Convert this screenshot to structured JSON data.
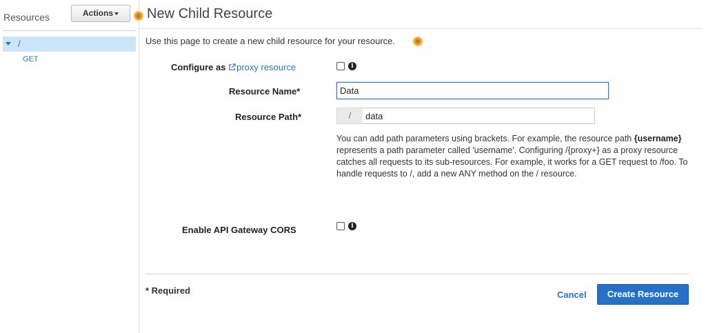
{
  "sidebar": {
    "title": "Resources",
    "actions_label": "Actions",
    "tree": {
      "root_label": "/",
      "methods": [
        "GET"
      ]
    }
  },
  "main": {
    "title": "New Child Resource",
    "intro": "Use this page to create a new child resource for your resource.",
    "configure_proxy": {
      "label_prefix": "Configure as",
      "link_text": "proxy resource",
      "checked": false
    },
    "resource_name": {
      "label": "Resource Name*",
      "value": "Data"
    },
    "resource_path": {
      "label": "Resource Path*",
      "prefix": "/",
      "value": "data"
    },
    "help": {
      "part1": "You can add path parameters using brackets. For example, the resource path ",
      "bold": "{username}",
      "part2": " represents a path parameter called 'username'. Configuring /{proxy+} as a proxy resource catches all requests to its sub-resources. For example, it works for a GET request to /foo. To handle requests to /, add a new ANY method on the / resource."
    },
    "cors": {
      "label": "Enable API Gateway CORS",
      "checked": false
    },
    "required_note": "* Required",
    "cancel_label": "Cancel",
    "create_label": "Create Resource"
  },
  "colors": {
    "accent": "#2671c7",
    "link": "#2b74c6",
    "selection": "#cde5fb",
    "highlight_dot": "#f59e1a"
  }
}
